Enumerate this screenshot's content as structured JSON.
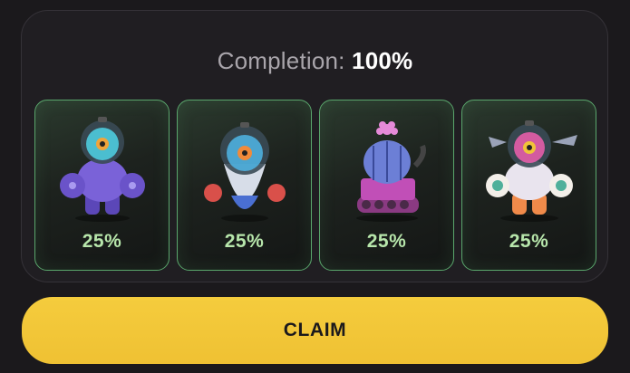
{
  "completion": {
    "label": "Completion:",
    "value": "100%"
  },
  "cards": [
    {
      "name": "purple-armored-robot",
      "percent": "25%",
      "colors": {
        "body": "#7a62d8",
        "dome": "#4fd3e6"
      }
    },
    {
      "name": "capsule-robot",
      "percent": "25%",
      "colors": {
        "body": "#d7dde8",
        "dome": "#4fb6e6"
      }
    },
    {
      "name": "cactus-tank",
      "percent": "25%",
      "colors": {
        "body": "#6c7fd6",
        "tank": "#c14fb7"
      }
    },
    {
      "name": "mech-robot",
      "percent": "25%",
      "colors": {
        "body": "#e9e4ee",
        "dome": "#ef5fae"
      }
    }
  ],
  "claim_button": {
    "label": "CLAIM",
    "color": "#f2c43a"
  },
  "theme": {
    "background": "#1b191c",
    "accent_green": "#5aa66c",
    "percent_text": "#b7e6ab"
  }
}
